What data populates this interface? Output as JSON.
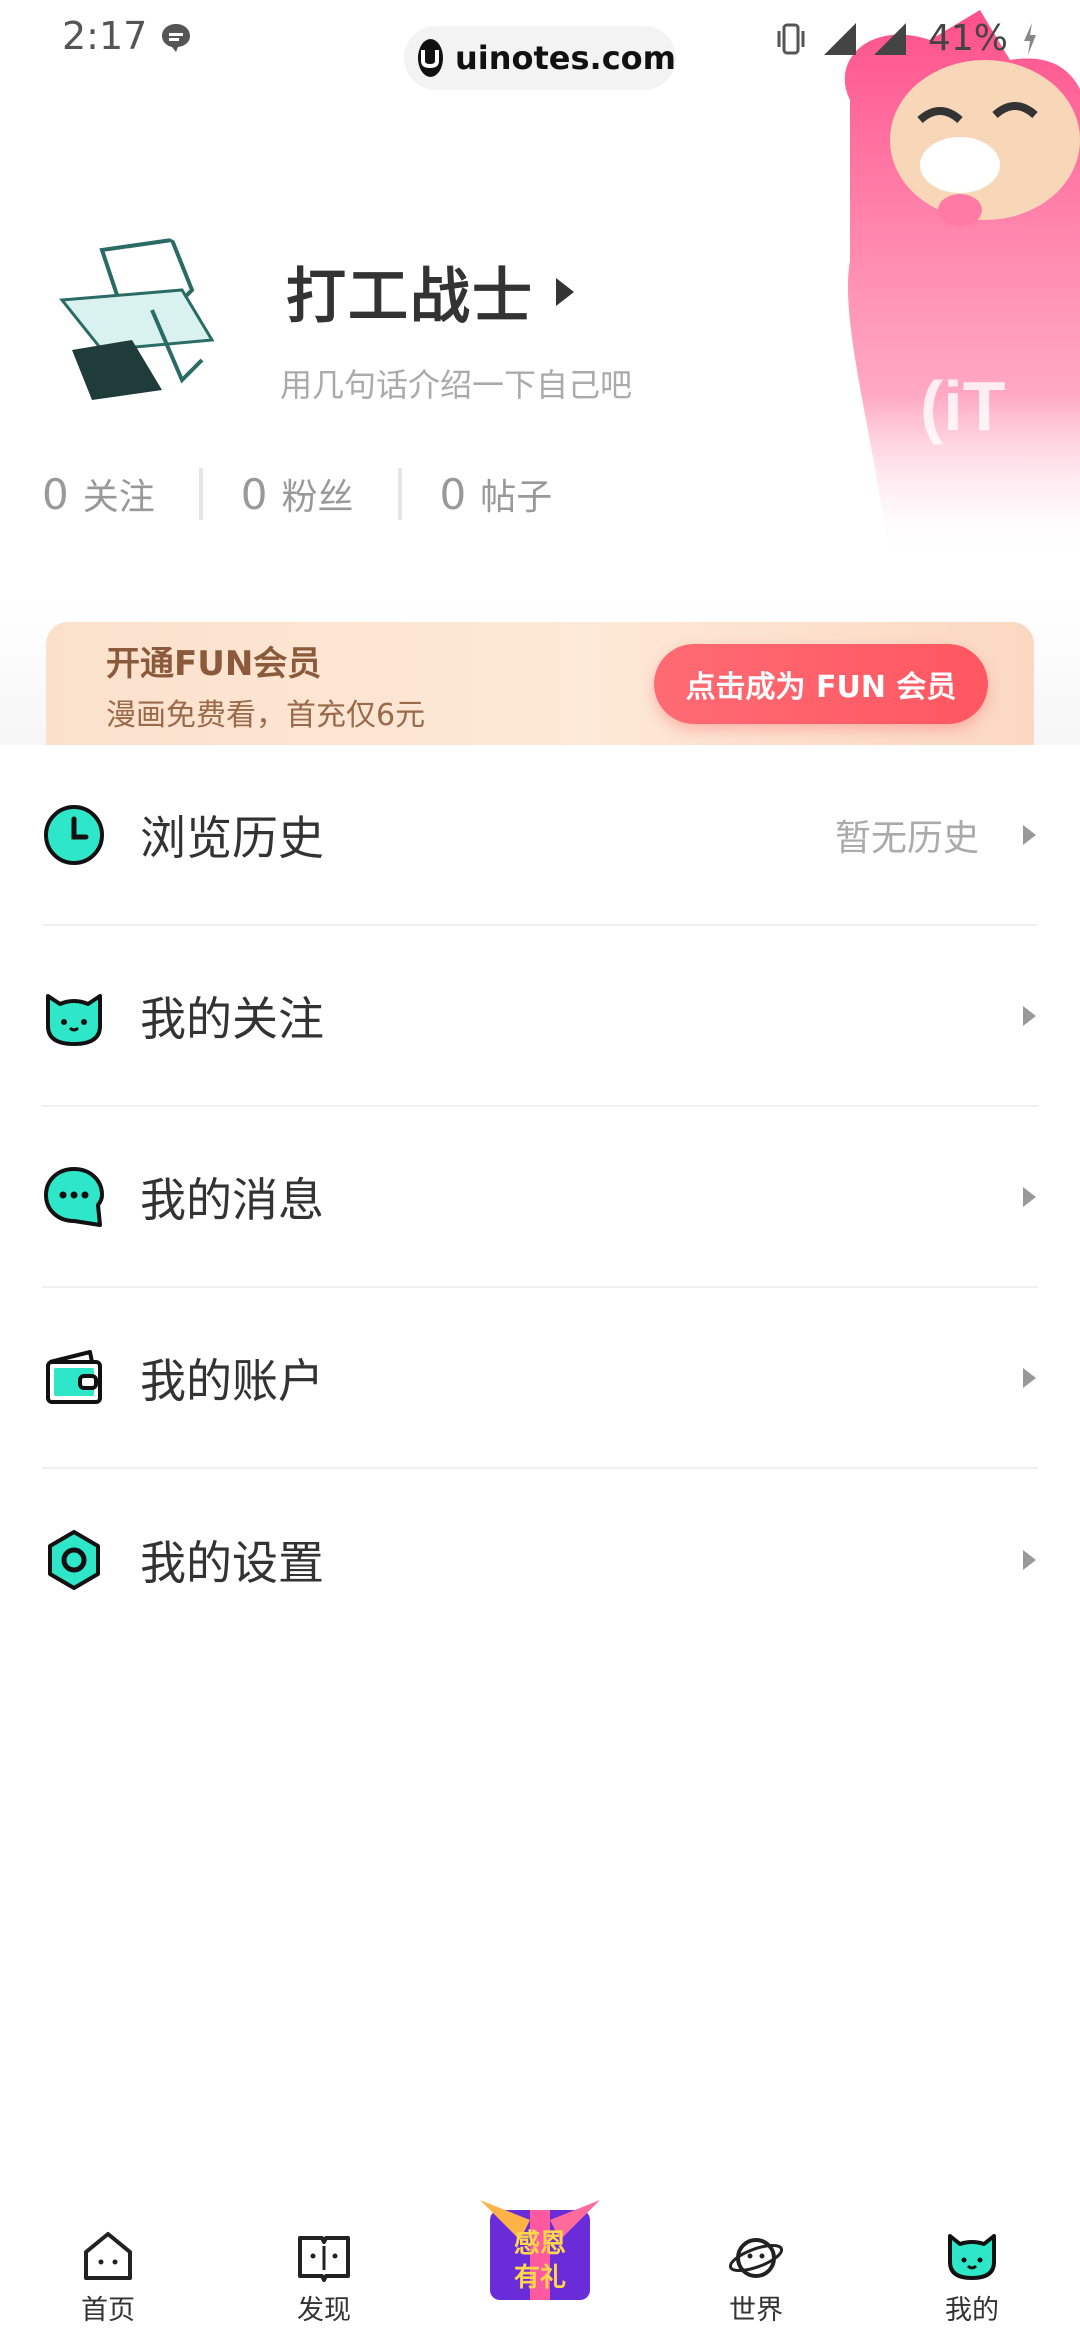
{
  "status_bar": {
    "time": "2:17",
    "url": "uinotes.com",
    "battery": "41%"
  },
  "profile": {
    "username": "打工战士",
    "bio": "用几句话介绍一下自己吧",
    "stats": [
      {
        "num": "0",
        "label": "关注"
      },
      {
        "num": "0",
        "label": "粉丝"
      },
      {
        "num": "0",
        "label": "帖子"
      }
    ]
  },
  "vip": {
    "title": "开通FUN会员",
    "subtitle": "漫画免费看，首充仅6元",
    "button": "点击成为 FUN 会员"
  },
  "menu": [
    {
      "label": "浏览历史",
      "hint": "暂无历史",
      "icon": "clock-icon"
    },
    {
      "label": "我的关注",
      "hint": "",
      "icon": "cat-face-icon"
    },
    {
      "label": "我的消息",
      "hint": "",
      "icon": "chat-bubble-icon"
    },
    {
      "label": "我的账户",
      "hint": "",
      "icon": "wallet-icon"
    },
    {
      "label": "我的设置",
      "hint": "",
      "icon": "hexagon-settings-icon"
    }
  ],
  "nav": [
    {
      "label": "首页",
      "icon": "home-icon"
    },
    {
      "label": "发现",
      "icon": "book-icon"
    },
    {
      "label": "",
      "icon": "promo-gift-icon",
      "promo_text": "感恩有礼"
    },
    {
      "label": "世界",
      "icon": "planet-icon"
    },
    {
      "label": "我的",
      "icon": "profile-cat-icon"
    }
  ],
  "colors": {
    "accent": "#2ee6c8",
    "vip_button": "#ff5a64",
    "mascot_pink": "#ff4f8b"
  }
}
